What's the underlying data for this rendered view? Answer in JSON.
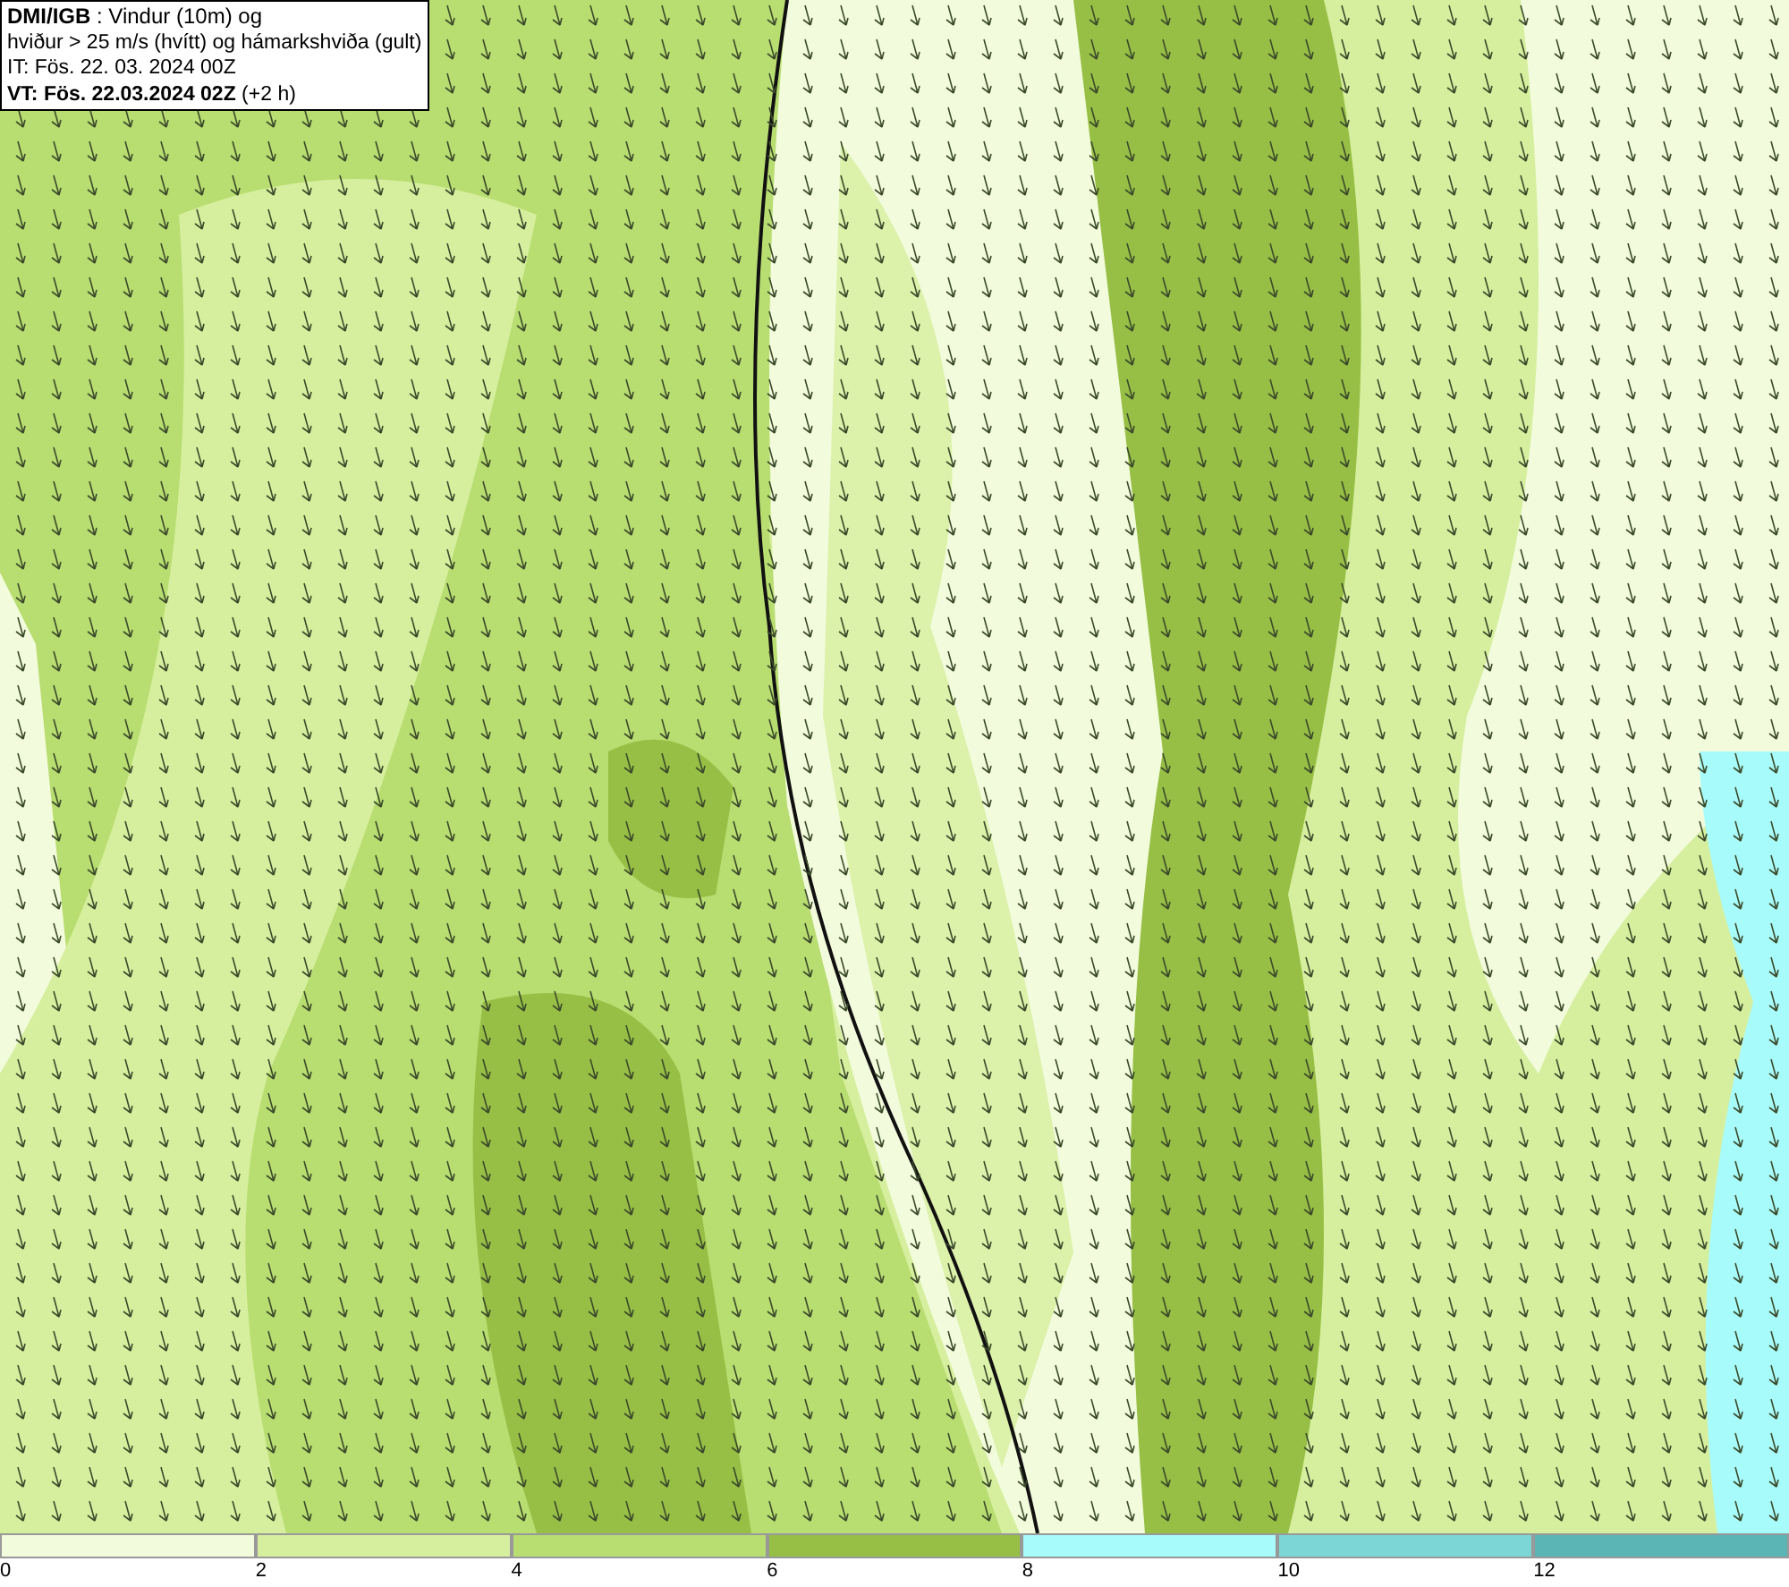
{
  "header": {
    "lines": [
      "**DMI/IGB** : Vindur (10m) og",
      "hviður > 25 m/s (hvítt) og hámarkshviða (gult)",
      "IT: Fös. 22. 03. 2024 00Z",
      "**VT: Fös. 22.03.2024 02Z** (+2 h)"
    ]
  },
  "legend": {
    "bins": [
      {
        "label": "0",
        "color": "#f2fbdc"
      },
      {
        "label": "2",
        "color": "#d6ef9e"
      },
      {
        "label": "4",
        "color": "#b8dd70"
      },
      {
        "label": "6",
        "color": "#97bf45"
      },
      {
        "label": "8",
        "color": "#a8fbfb"
      },
      {
        "label": "10",
        "color": "#7dd6d6"
      },
      {
        "label": "12",
        "color": "#5bb5b5"
      }
    ]
  }
}
